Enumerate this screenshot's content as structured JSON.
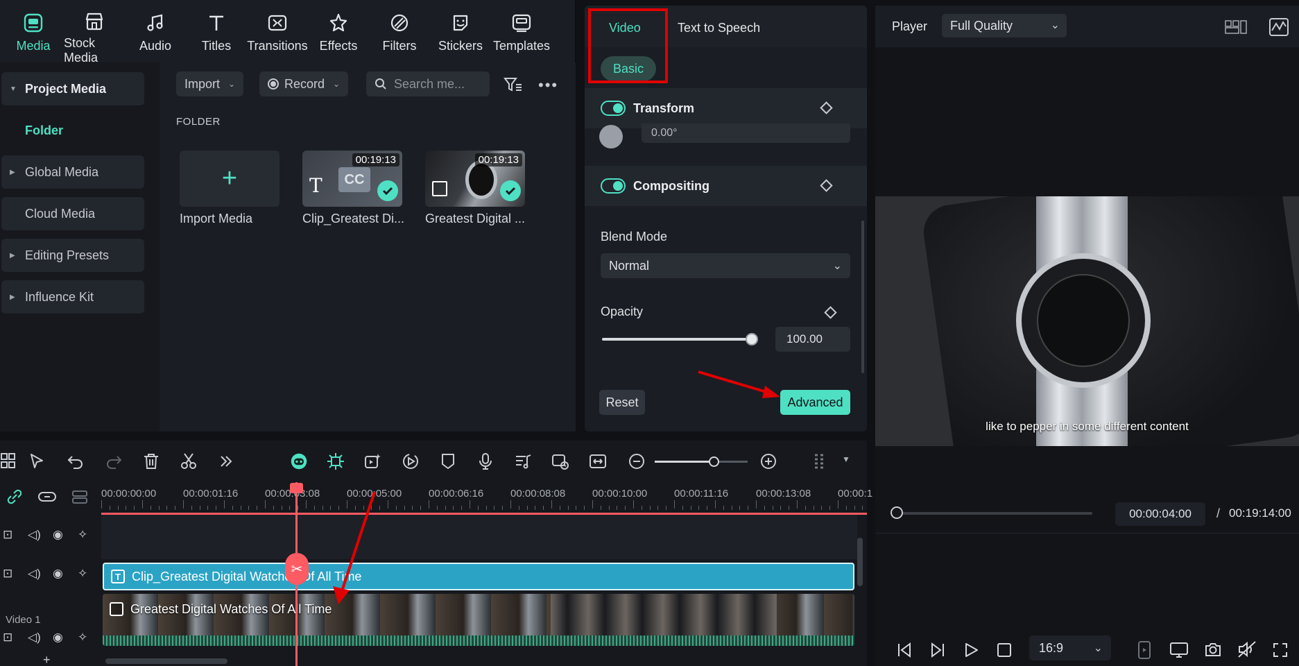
{
  "media_tabs": [
    {
      "label": "Media",
      "icon": "media-icon",
      "active": true
    },
    {
      "label": "Stock Media",
      "icon": "stock-media-icon"
    },
    {
      "label": "Audio",
      "icon": "audio-icon"
    },
    {
      "label": "Titles",
      "icon": "titles-icon"
    },
    {
      "label": "Transitions",
      "icon": "transitions-icon"
    },
    {
      "label": "Effects",
      "icon": "effects-icon"
    },
    {
      "label": "Filters",
      "icon": "filters-icon"
    },
    {
      "label": "Stickers",
      "icon": "stickers-icon"
    },
    {
      "label": "Templates",
      "icon": "templates-icon"
    }
  ],
  "sidebar": {
    "project_media": "Project Media",
    "folder": "Folder",
    "global_media": "Global Media",
    "cloud_media": "Cloud Media",
    "editing_presets": "Editing Presets",
    "influence_kit": "Influence Kit"
  },
  "media_toolbar": {
    "import": "Import",
    "record": "Record",
    "search_placeholder": "Search me..."
  },
  "folder_label": "FOLDER",
  "media_items": [
    {
      "name": "Import Media"
    },
    {
      "name": "Clip_Greatest Di...",
      "duration": "00:19:13",
      "badge": "CC"
    },
    {
      "name": "Greatest Digital ...",
      "duration": "00:19:13"
    }
  ],
  "props": {
    "tabs": {
      "video": "Video",
      "tts": "Text to Speech"
    },
    "subtab": "Basic",
    "transform": "Transform",
    "rotate_value": "0.00°",
    "compositing": "Compositing",
    "blend_mode_label": "Blend Mode",
    "blend_mode_value": "Normal",
    "opacity_label": "Opacity",
    "opacity_value": "100.00",
    "opacity_level": 1.0,
    "reset": "Reset",
    "advanced": "Advanced"
  },
  "player": {
    "label": "Player",
    "quality": "Full Quality",
    "caption": "like to pepper in some different content",
    "current_time": "00:00:04:00",
    "separator": "/",
    "total_time": "00:19:14:00",
    "aspect": "16:9"
  },
  "timeline": {
    "ticks": [
      "00:00:00:00",
      "00:00:01:16",
      "00:00:03:08",
      "00:00:05:00",
      "00:00:06:16",
      "00:00:08:08",
      "00:00:10:00",
      "00:00:11:16",
      "00:00:13:08",
      "00:00:1"
    ],
    "title_clip": "Clip_Greatest Digital Watches Of All Time",
    "video_clip": "Greatest Digital Watches Of All Time",
    "video_track": "Video 1"
  },
  "colors": {
    "accent": "#4fe0c3",
    "highlight": "#e00000",
    "playhead": "#ff5b63",
    "title_clip": "#2ba3c5"
  }
}
